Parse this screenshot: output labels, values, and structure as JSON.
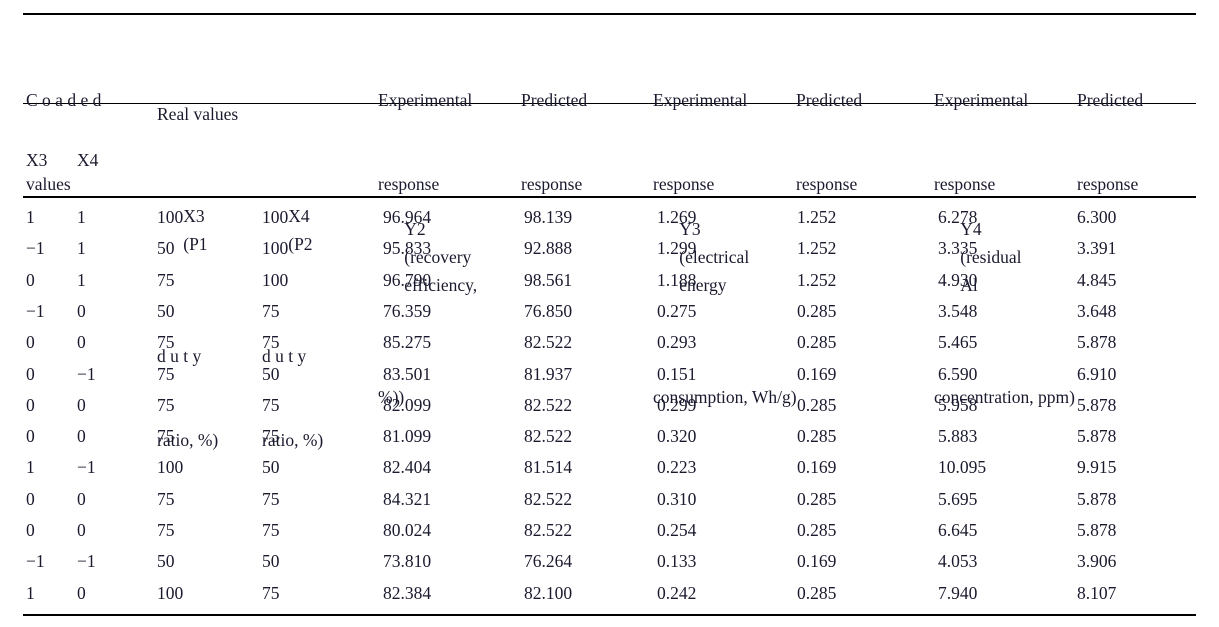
{
  "table": {
    "header_groups": [
      {
        "label": "Coaded values",
        "spaced_first_word": true
      },
      {
        "label": "Real values",
        "spaced_first_word": false
      },
      {
        "label": "Experimental response",
        "spaced_first_word": false
      },
      {
        "label": "Predicted response",
        "spaced_first_word": false
      },
      {
        "label": "Experimental response",
        "spaced_first_word": false
      },
      {
        "label": "Predicted response",
        "spaced_first_word": false
      },
      {
        "label": "Experimental response",
        "spaced_first_word": false
      },
      {
        "label": "Predicted response",
        "spaced_first_word": false
      }
    ],
    "header_groups_lines": {
      "coaded": {
        "line1": "C o a d e d",
        "line2": "values"
      },
      "real": {
        "line1": "Real values"
      },
      "exp1": {
        "line1": "Experimental",
        "line2": "response"
      },
      "pred1": {
        "line1": "Predicted",
        "line2": "response"
      },
      "exp2": {
        "line1": "Experimental",
        "line2": "response"
      },
      "pred2": {
        "line1": "Predicted",
        "line2": "response"
      },
      "exp3": {
        "line1": "Experimental",
        "line2": "response"
      },
      "pred3": {
        "line1": "Predicted",
        "line2": "response"
      }
    },
    "header_vars": {
      "x3": "X3",
      "x4": "X4",
      "real_x3": {
        "l1a": "X3",
        "l1b": "(P1",
        "l2": "d u t y",
        "l3": "ratio, %)"
      },
      "real_x4": {
        "l1a": "X4",
        "l1b": "(P2",
        "l2": "d u t y",
        "l3": "ratio, %)"
      },
      "y2": {
        "l1a": "Y2",
        "l1b": "(recovery",
        "l1c": "efficiency,",
        "l2": "%))"
      },
      "y3": {
        "l1a": "Y3",
        "l1b": "(electrical",
        "l1c": "energy",
        "l2": "consumption, Wh/g)"
      },
      "y4": {
        "l1a": "Y4",
        "l1b": "(residual",
        "l1c": "Al",
        "l2": "concentration, ppm)"
      }
    },
    "columns": [
      "X3",
      "X4",
      "X3 (P1 duty ratio, %)",
      "X4 (P2 duty ratio, %)",
      "Y2 (recovery efficiency, %)) experimental",
      "Y2 (recovery efficiency, %)) predicted",
      "Y3 (electrical energy consumption, Wh/g) experimental",
      "Y3 (electrical energy consumption, Wh/g) predicted",
      "Y4 (residual Al concentration, ppm) experimental",
      "Y4 (residual Al concentration, ppm) predicted"
    ],
    "rows": [
      [
        "1",
        "1",
        "100",
        "100",
        "96.964",
        "98.139",
        "1.269",
        "1.252",
        "6.278",
        "6.300"
      ],
      [
        "−1",
        "1",
        "50",
        "100",
        "95.833",
        "92.888",
        "1.299",
        "1.252",
        "3.335",
        "3.391"
      ],
      [
        "0",
        "1",
        "75",
        "100",
        "96.790",
        "98.561",
        "1.188",
        "1.252",
        "4.930",
        "4.845"
      ],
      [
        "−1",
        "0",
        "50",
        "75",
        "76.359",
        "76.850",
        "0.275",
        "0.285",
        "3.548",
        "3.648"
      ],
      [
        "0",
        "0",
        "75",
        "75",
        "85.275",
        "82.522",
        "0.293",
        "0.285",
        "5.465",
        "5.878"
      ],
      [
        "0",
        "−1",
        "75",
        "50",
        "83.501",
        "81.937",
        "0.151",
        "0.169",
        "6.590",
        "6.910"
      ],
      [
        "0",
        "0",
        "75",
        "75",
        "82.099",
        "82.522",
        "0.299",
        "0.285",
        "5.958",
        "5.878"
      ],
      [
        "0",
        "0",
        "75",
        "75",
        "81.099",
        "82.522",
        "0.320",
        "0.285",
        "5.883",
        "5.878"
      ],
      [
        "1",
        "−1",
        "100",
        "50",
        "82.404",
        "81.514",
        "0.223",
        "0.169",
        "10.095",
        "9.915"
      ],
      [
        "0",
        "0",
        "75",
        "75",
        "84.321",
        "82.522",
        "0.310",
        "0.285",
        "5.695",
        "5.878"
      ],
      [
        "0",
        "0",
        "75",
        "75",
        "80.024",
        "82.522",
        "0.254",
        "0.285",
        "6.645",
        "5.878"
      ],
      [
        "−1",
        "−1",
        "50",
        "50",
        "73.810",
        "76.264",
        "0.133",
        "0.169",
        "4.053",
        "3.906"
      ],
      [
        "1",
        "0",
        "100",
        "75",
        "82.384",
        "82.100",
        "0.242",
        "0.285",
        "7.940",
        "8.107"
      ]
    ]
  }
}
